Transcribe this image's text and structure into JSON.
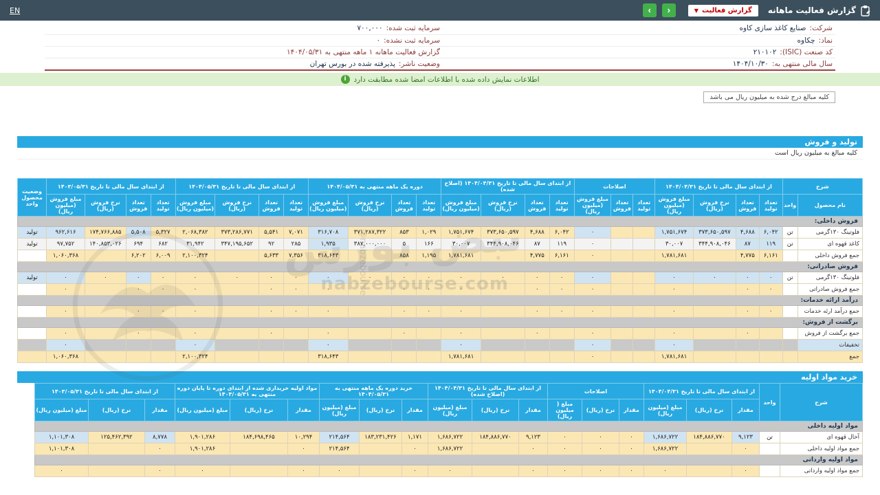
{
  "topbar": {
    "title": "گزارش فعالیت ماهانه",
    "dropdown_label": "گزارش فعالیت",
    "nav_next": "‹",
    "nav_prev": "›",
    "en_label": "EN"
  },
  "colors": {
    "topbar_bg": "#3c4f5c",
    "accent_blue": "#29a9e1",
    "cell_yellow": "#fbe7b4",
    "cell_blue": "#cfe3f2",
    "banner_green_bg": "#ddf0cf",
    "button_green": "#43b14b",
    "dropdown_text_red": "#c40000",
    "separator_maroon": "#a04040"
  },
  "header": {
    "rows": [
      {
        "r_label": "شرکت:",
        "r_value": "صنایع کاغذ سازی کاوه",
        "l_label": "سرمایه ثبت شده:",
        "l_value": "۷۰۰,۰۰۰"
      },
      {
        "r_label": "نماد:",
        "r_value": "چکاوه",
        "l_label": "سرمایه ثبت نشده:",
        "l_value": "۰"
      },
      {
        "r_label": "کد صنعت (ISIC):",
        "r_value": "۲۱۰۱۰۲",
        "l_label": "گزارش فعالیت ماهانه ۱ ماهه منتهی به ۱۴۰۴/۰۵/۳۱",
        "l_value": ""
      },
      {
        "r_label": "سال مالی منتهی به:",
        "r_value": "۱۴۰۴/۱۰/۳۰",
        "l_label": "وضعیت ناشر:",
        "l_value": "پذیرفته شده در بورس تهران"
      }
    ]
  },
  "banner": {
    "text": "اطلاعات نمایش داده شده با اطلاعات امضا شده مطابقت دارد"
  },
  "note_box": {
    "text": "کلیه مبالغ درج شده به میلیون ریال می باشد"
  },
  "watermark": {
    "brand_fa": "نبض بورس",
    "domain": "nabzebourse.com",
    "handle": "@nabzebourse"
  },
  "sections": {
    "production": {
      "title": "تولید و فروش",
      "subtitle": "کلیه مبالغ به میلیون ریال است"
    },
    "materials": {
      "title": "خرید مواد اولیه"
    }
  },
  "tables": {
    "production": {
      "lead_label": "شرح",
      "lead_sub": [
        "نام محصول",
        "واحد"
      ],
      "status_label": "وضعیت محصول واحد",
      "groups": [
        {
          "label": "از ابتدای سال مالی تا تاریخ ۱۴۰۴/۰۴/۳۱",
          "cols": [
            "تعداد تولید",
            "تعداد فروش",
            "نرخ فروش (ریال)",
            "مبلغ فروش (میلیون ریال)"
          ]
        },
        {
          "label": "اصلاحات",
          "cols": [
            "تعداد تولید",
            "تعداد فروش",
            "مبلغ فروش (میلیون ریال)"
          ]
        },
        {
          "label": "از ابتدای سال مالی تا تاریخ ۱۴۰۴/۰۴/۳۱ (اصلاح شده)",
          "cols": [
            "تعداد تولید",
            "تعداد فروش",
            "نرخ فروش (ریال)",
            "مبلغ فروش (میلیون ریال)"
          ]
        },
        {
          "label": "دوره یک ماهه منتهی به ۱۴۰۴/۰۵/۳۱",
          "cols": [
            "تعداد تولید",
            "تعداد فروش",
            "نرخ فروش (ریال)",
            "مبلغ فروش (میلیون ریال)"
          ]
        },
        {
          "label": "از ابتدای سال مالی تا تاریخ ۱۴۰۴/۰۵/۳۱",
          "cols": [
            "تعداد تولید",
            "تعداد فروش",
            "نرخ فروش (ریال)",
            "مبلغ فروش (میلیون ریال)"
          ]
        },
        {
          "label": "از ابتدای سال مالی تا تاریخ ۱۴۰۳/۰۵/۳۱",
          "cols": [
            "تعداد تولید",
            "تعداد فروش",
            "نرخ فروش (ریال)",
            "مبلغ فروش (میلیون ریال)"
          ]
        }
      ],
      "rows": [
        {
          "type": "group",
          "label": "فروش داخلی:"
        },
        {
          "type": "data",
          "label": "فلوتینگ ۱۳۰گرمی",
          "unit": "تن",
          "status": "تولید",
          "hl": [
            0,
            1,
            2,
            3,
            6,
            14,
            20,
            22
          ],
          "cells": [
            "۶,۰۴۲",
            "۴,۶۸۸",
            "۳۷۳,۶۵۰,۵۹۷",
            "۱,۷۵۱,۶۷۴",
            "",
            "",
            "۰",
            "۶,۰۴۲",
            "۴,۶۸۸",
            "۳۷۳,۶۵۰,۵۹۷",
            "۱,۷۵۱,۶۷۴",
            "۱,۰۲۹",
            "۸۵۳",
            "۳۷۱,۲۸۷,۳۲۲",
            "۳۱۶,۷۰۸",
            "۷,۰۷۱",
            "۵,۵۴۱",
            "۳۷۳,۲۸۶,۷۷۱",
            "۲,۰۶۸,۳۸۲",
            "۵,۳۲۷",
            "۵,۵۰۸",
            "۱۷۴,۷۶۶,۸۸۵",
            "۹۶۲,۶۱۶"
          ]
        },
        {
          "type": "data-alt",
          "label": "کاغذ قهوه ای",
          "unit": "تن",
          "status": "تولید",
          "hl": [
            0,
            1,
            14
          ],
          "cells": [
            "۱۱۹",
            "۸۷",
            "۳۴۴,۹۰۸,۰۴۶",
            "۳۰,۰۰۷",
            "",
            "",
            "۰",
            "۱۱۹",
            "۸۷",
            "۳۴۴,۹۰۸,۰۴۶",
            "۳۰,۰۰۷",
            "۱۶۶",
            "۵",
            "۳۸۷,۰۰۰,۰۰۰",
            "۱,۹۳۵",
            "۲۸۵",
            "۹۲",
            "۳۴۷,۱۹۵,۶۵۲",
            "۳۱,۹۴۲",
            "۶۸۲",
            "۶۹۴",
            "۱۴۰,۸۵۳,۰۲۶",
            "۹۷,۷۵۲"
          ]
        },
        {
          "type": "total",
          "label": "جمع فروش داخلی",
          "unit": "",
          "status": "",
          "hl": [],
          "cells": [
            "۶,۱۶۱",
            "۴,۷۷۵",
            "",
            "۱,۷۸۱,۶۸۱",
            "",
            "",
            "۰",
            "۶,۱۶۱",
            "۴,۷۷۵",
            "",
            "۱,۷۸۱,۶۸۱",
            "۱,۱۹۵",
            "۸۵۸",
            "",
            "۳۱۸,۶۴۳",
            "۷,۳۵۶",
            "۵,۶۳۳",
            "",
            "۲,۱۰۰,۳۲۴",
            "۶,۰۰۹",
            "۶,۲۰۲",
            "",
            "۱,۰۶۰,۳۶۸"
          ]
        },
        {
          "type": "group",
          "label": "فروش صادراتی:"
        },
        {
          "type": "data",
          "label": "فلوتینگ ۱۳۰گرمی",
          "unit": "تن",
          "status": "تولید",
          "hl": [
            0,
            1,
            2,
            3,
            6,
            14,
            20,
            22
          ],
          "cells": [
            "۰",
            "۰",
            "۰",
            "۰",
            "",
            "",
            "۰",
            "۰",
            "۰",
            "۰",
            "۰",
            "۰",
            "۰",
            "۰",
            "۰",
            "۰",
            "۰",
            "۰",
            "۰",
            "۰",
            "۰",
            "۰",
            "۰"
          ]
        },
        {
          "type": "total",
          "label": "جمع فروش صادراتی",
          "unit": "",
          "status": "",
          "hl": [],
          "cells": [
            "۰",
            "۰",
            "",
            "۰",
            "",
            "",
            "۰",
            "۰",
            "۰",
            "",
            "۰",
            "۰",
            "۰",
            "",
            "۰",
            "۰",
            "۰",
            "",
            "۰",
            "۰",
            "۰",
            "",
            "۰"
          ]
        },
        {
          "type": "group",
          "label": "درآمد ارائه خدمات:"
        },
        {
          "type": "total",
          "label": "جمع درآمد ارئه خدمات",
          "unit": "",
          "status": "",
          "hl": [],
          "cells": [
            "۰",
            "۰",
            "",
            "۰",
            "",
            "",
            "۰",
            "۰",
            "۰",
            "",
            "۰",
            "۰",
            "۰",
            "",
            "۰",
            "۰",
            "۰",
            "",
            "۰",
            "۰",
            "۰",
            "",
            "۰"
          ]
        },
        {
          "type": "group",
          "label": "برگشت از فروش:"
        },
        {
          "type": "total",
          "label": "جمع برگشت از فروش",
          "unit": "",
          "status": "",
          "hl": [],
          "cells": [
            "",
            "۰",
            "",
            "۰",
            "",
            "",
            "۰",
            "",
            "۰",
            "",
            "۰",
            "",
            "۰",
            "",
            "۰",
            "",
            "۰",
            "",
            "۰",
            "",
            "۰",
            "",
            "۰"
          ]
        },
        {
          "type": "disc",
          "label": "تخفیفات",
          "unit": "",
          "status": "",
          "hl": [
            3,
            6,
            10,
            14,
            18,
            22
          ],
          "cells": [
            "",
            "",
            "",
            "۰",
            "",
            "",
            "۰",
            "",
            "",
            "",
            "۰",
            "",
            "",
            "",
            "۰",
            "",
            "",
            "",
            "۰",
            "",
            "",
            "",
            "۰"
          ]
        },
        {
          "type": "grand",
          "label": "جمع",
          "unit": "",
          "status": "",
          "hl": [],
          "cells": [
            "",
            "",
            "",
            "۱,۷۸۱,۶۸۱",
            "",
            "",
            "۰",
            "",
            "",
            "",
            "۱,۷۸۱,۶۸۱",
            "",
            "",
            "",
            "۳۱۸,۶۴۳",
            "",
            "",
            "",
            "۲,۱۰۰,۳۲۴",
            "",
            "",
            "",
            "۱,۰۶۰,۳۶۸"
          ]
        }
      ]
    },
    "materials": {
      "lead_label": "شرح",
      "unit_label": "واحد",
      "groups": [
        {
          "label": "از ابتدای سال مالی تا تاریخ ۱۴۰۴/۰۴/۳۱",
          "cols": [
            "مقدار",
            "نرخ (ریال)",
            "مبلغ (میلیون ریال)"
          ]
        },
        {
          "label": "اصلاحات",
          "cols": [
            "مقدار",
            "نرخ (ریال)",
            "مبلغ ( میلیون ریال)"
          ]
        },
        {
          "label": "از ابتدای سال مالی تا تاریخ ۱۴۰۴/۰۴/۳۱ (اصلاح شده)",
          "cols": [
            "مقدار",
            "نرخ (ریال)",
            "مبلغ (میلیون ریال)"
          ]
        },
        {
          "label": "خرید دوره یک ماهه منتهی به ۱۴۰۴/۰۵/۳۱",
          "cols": [
            "مقدار",
            "نرخ (ریال)",
            "مبلغ (میلیون ریال)"
          ]
        },
        {
          "label": "مواد اولیه خریداری شده از ابتدای دوره تا پایان دوره منتهی به ۱۴۰۴/۰۵/۳۱",
          "cols": [
            "مقدار",
            "نرخ (ریال)",
            "مبلغ (میلیون ریال)"
          ]
        },
        {
          "label": "از ابتدای سال مالی تا تاریخ ۱۴۰۳/۰۵/۳۱",
          "cols": [
            "مقدار",
            "نرخ (ریال)",
            "مبلغ (میلیون ریال)"
          ]
        }
      ],
      "rows": [
        {
          "type": "group",
          "label": "مواد اولیه داخلی"
        },
        {
          "type": "data",
          "label": "آخال قهوه ای",
          "unit": "تن",
          "hl": [
            0,
            2,
            11,
            15,
            17
          ],
          "cells": [
            "۹,۱۲۳",
            "۱۸۴,۸۸۶,۷۷۰",
            "۱,۶۸۶,۷۲۲",
            "۰",
            "۰",
            "۰",
            "۹,۱۲۳",
            "۱۸۴,۸۸۶,۷۷۰",
            "۱,۶۸۶,۷۲۲",
            "۱,۱۷۱",
            "۱۸۳,۲۳۱,۴۲۶",
            "۲۱۴,۵۶۴",
            "۱۰,۲۹۴",
            "۱۸۴,۶۹۸,۴۶۵",
            "۱,۹۰۱,۲۸۶",
            "۸,۷۷۸",
            "۱۲۵,۴۶۲,۳۹۲",
            "۱,۱۰۱,۳۰۸"
          ]
        },
        {
          "type": "total",
          "label": "جمع مواد اولیه داخلی",
          "unit": "",
          "hl": [],
          "cells": [
            "۰",
            "",
            "۱,۶۸۶,۷۲۲",
            "۰",
            "۰",
            "۰",
            "۰",
            "",
            "۱,۶۸۶,۷۲۲",
            "۰",
            "",
            "۲۱۴,۵۶۴",
            "۰",
            "",
            "۱,۹۰۱,۲۸۶",
            "۰",
            "",
            "۱,۱۰۱,۳۰۸"
          ]
        },
        {
          "type": "group",
          "label": "مواد اولیه وارداتی"
        },
        {
          "type": "total",
          "label": "جمع مواد اولیه وارداتی",
          "unit": "",
          "hl": [],
          "cells": [
            "۰",
            "",
            "۰",
            "۰",
            "۰",
            "۰",
            "۰",
            "",
            "۰",
            "۰",
            "",
            "۰",
            "۰",
            "",
            "۰",
            "۰",
            "",
            "۰"
          ]
        }
      ]
    }
  }
}
